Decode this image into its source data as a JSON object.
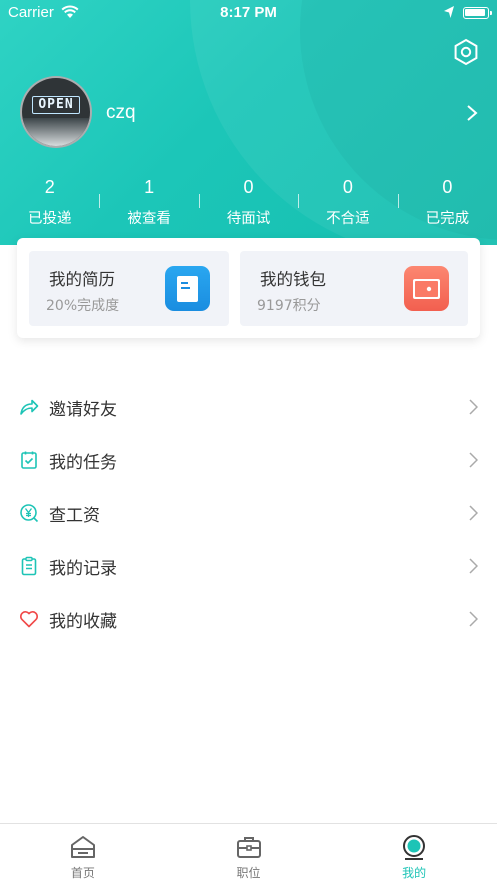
{
  "status_bar": {
    "carrier": "Carrier",
    "time": "8:17 PM"
  },
  "colors": {
    "accent": "#1dc4b6",
    "hero": "#1cc6b8",
    "resume_icon": "#1a8de0",
    "wallet_icon": "#f25f4f",
    "favorite_icon": "#f04848"
  },
  "profile": {
    "avatar_sign": "OPEN",
    "username": "czq"
  },
  "stats": [
    {
      "value": "2",
      "label": "已投递"
    },
    {
      "value": "1",
      "label": "被查看"
    },
    {
      "value": "0",
      "label": "待面试"
    },
    {
      "value": "0",
      "label": "不合适"
    },
    {
      "value": "0",
      "label": "已完成"
    }
  ],
  "cards": {
    "resume": {
      "title": "我的简历",
      "subtitle": "20%完成度",
      "icon": "document-icon"
    },
    "wallet": {
      "title": "我的钱包",
      "subtitle": "9197积分",
      "icon": "wallet-icon"
    }
  },
  "menu": [
    {
      "label": "邀请好友",
      "icon": "share-arrow-icon"
    },
    {
      "label": "我的任务",
      "icon": "task-check-icon"
    },
    {
      "label": "查工资",
      "icon": "yen-search-icon"
    },
    {
      "label": "我的记录",
      "icon": "clipboard-icon"
    },
    {
      "label": "我的收藏",
      "icon": "heart-icon"
    }
  ],
  "tabbar": [
    {
      "label": "首页",
      "icon": "home-icon"
    },
    {
      "label": "职位",
      "icon": "briefcase-icon"
    },
    {
      "label": "我的",
      "icon": "profile-icon",
      "active": true
    }
  ]
}
